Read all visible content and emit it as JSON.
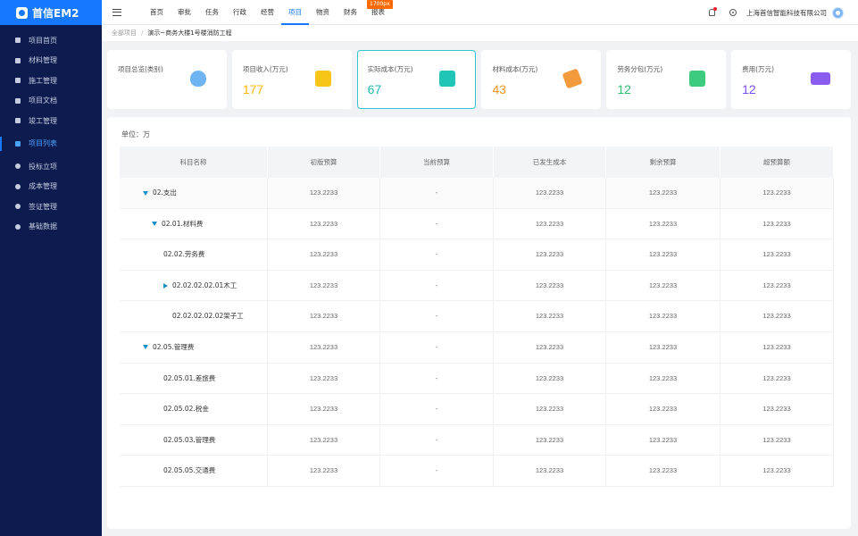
{
  "app": {
    "logo_text": "首信EM2"
  },
  "sidebar": {
    "items": [
      {
        "label": "项目首页",
        "icon": "home-icon"
      },
      {
        "label": "材料管理",
        "icon": "material-icon"
      },
      {
        "label": "施工管理",
        "icon": "construction-icon"
      },
      {
        "label": "项目文档",
        "icon": "document-icon"
      },
      {
        "label": "竣工管理",
        "icon": "completion-icon"
      },
      {
        "label": "项目列表",
        "icon": "grid-icon",
        "active": true
      },
      {
        "label": "投标立项",
        "icon": "bid-icon"
      },
      {
        "label": "成本管理",
        "icon": "cost-icon"
      },
      {
        "label": "签证管理",
        "icon": "visa-icon"
      },
      {
        "label": "基础数据",
        "icon": "database-icon"
      }
    ]
  },
  "topnav": {
    "items": [
      "首页",
      "审批",
      "任务",
      "行政",
      "经营",
      "项目",
      "物资",
      "财务",
      "报表"
    ],
    "active": "项目",
    "width_badge": "1700px",
    "company": "上海首信智能科技有限公司"
  },
  "breadcrumb": {
    "root": "全部项目",
    "separator": "/",
    "current": "演示~商务大楼1号楼消防工程"
  },
  "cards": [
    {
      "label": "项目总览(类别)",
      "value": "",
      "icon": "drop-icon",
      "color": "#6fb4f2"
    },
    {
      "label": "项目收入(万元)",
      "value": "177",
      "icon": "folder-icon",
      "color": "#f5b800"
    },
    {
      "label": "实际成本(万元)",
      "value": "67",
      "icon": "clipboard-icon",
      "color": "#1fb6b0",
      "selected": true
    },
    {
      "label": "材料成本(万元)",
      "value": "43",
      "icon": "tag-icon",
      "color": "#f0921f"
    },
    {
      "label": "劳务分包(万元)",
      "value": "12",
      "icon": "cube-icon",
      "color": "#2fbf71"
    },
    {
      "label": "费用(万元)",
      "value": "12",
      "icon": "wallet-icon",
      "color": "#7a4df0"
    }
  ],
  "unit_label": "单位：万",
  "table": {
    "headers": [
      "科目名称",
      "初版预算",
      "当前预算",
      "已发生成本",
      "剩余预算",
      "超预算额"
    ],
    "rows": [
      {
        "name": "02.支出",
        "level": 0,
        "caret": "down",
        "cells": [
          "123.2233",
          "-",
          "123.2233",
          "123.2233",
          "123.2233"
        ]
      },
      {
        "name": "02.01.材料费",
        "level": 1,
        "caret": "down",
        "cells": [
          "123.2233",
          "-",
          "123.2233",
          "123.2233",
          "123.2233"
        ]
      },
      {
        "name": "02.02.劳务费",
        "level": 2,
        "caret": "",
        "cells": [
          "123.2233",
          "-",
          "123.2233",
          "123.2233",
          "123.2233"
        ]
      },
      {
        "name": "02.02.02.02.01木工",
        "level": 2,
        "caret": "right",
        "cells": [
          "123.2233",
          "-",
          "123.2233",
          "123.2233",
          "123.2233"
        ]
      },
      {
        "name": "02.02.02.02.02架子工",
        "level": 3,
        "caret": "",
        "cells": [
          "123.2233",
          "-",
          "123.2233",
          "123.2233",
          "123.2233"
        ]
      },
      {
        "name": "02.05.管理费",
        "level": 0,
        "caret": "down",
        "cells": [
          "123.2233",
          "-",
          "123.2233",
          "123.2233",
          "123.2233"
        ]
      },
      {
        "name": "02.05.01.差旅费",
        "level": 2,
        "caret": "",
        "cells": [
          "123.2233",
          "-",
          "123.2233",
          "123.2233",
          "123.2233"
        ]
      },
      {
        "name": "02.05.02.税金",
        "level": 2,
        "caret": "",
        "cells": [
          "123.2233",
          "-",
          "123.2233",
          "123.2233",
          "123.2233"
        ]
      },
      {
        "name": "02.05.03.管理费",
        "level": 2,
        "caret": "",
        "cells": [
          "123.2233",
          "-",
          "123.2233",
          "123.2233",
          "123.2233"
        ]
      },
      {
        "name": "02.05.05.交通费",
        "level": 2,
        "caret": "",
        "cells": [
          "123.2233",
          "-",
          "123.2233",
          "123.2233",
          "123.2233"
        ]
      }
    ]
  }
}
